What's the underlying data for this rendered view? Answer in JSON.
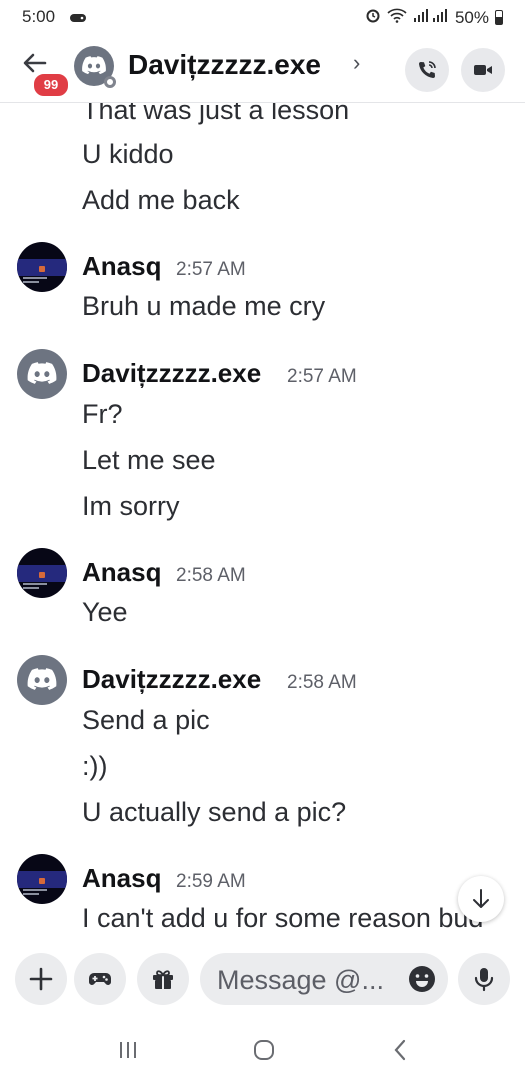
{
  "status_bar": {
    "time": "5:00",
    "battery": "50%"
  },
  "header": {
    "back_badge": "99",
    "title": "Davițzzzzz.exe",
    "chevron": "›"
  },
  "messages": [
    {
      "type": "continuation",
      "lines": [
        "That was just a lesson",
        "U kiddo",
        "Add me back"
      ]
    },
    {
      "type": "group",
      "author": "Anasq",
      "time": "2:57 AM",
      "avatar": "anasq-avatar",
      "lines": [
        "Bruh u made me cry"
      ]
    },
    {
      "type": "group",
      "author": "Davițzzzzz.exe",
      "time": "2:57 AM",
      "avatar": "discord-default-avatar",
      "lines": [
        "Fr?",
        "Let me see",
        "Im sorry"
      ]
    },
    {
      "type": "group",
      "author": "Anasq",
      "time": "2:58 AM",
      "avatar": "anasq-avatar",
      "lines": [
        "Yee"
      ]
    },
    {
      "type": "group",
      "author": "Davițzzzzz.exe",
      "time": "2:58 AM",
      "avatar": "discord-default-avatar",
      "lines": [
        "Send a pic",
        ":))",
        "U actually send a pic?"
      ]
    },
    {
      "type": "group",
      "author": "Anasq",
      "time": "2:59 AM",
      "avatar": "anasq-avatar",
      "lines": [
        "I can't add u for some reason bud"
      ]
    }
  ],
  "composer": {
    "placeholder": "Message @..."
  },
  "icons": [
    "back-arrow-icon",
    "phone-call-icon",
    "video-camera-icon",
    "plus-icon",
    "gamepad-icon",
    "gift-icon",
    "emoji-icon",
    "microphone-icon",
    "arrow-down-icon",
    "recents-icon",
    "home-icon",
    "back-nav-icon"
  ],
  "colors": {
    "badge": "#e03d45",
    "button_bg": "#ebecee",
    "default_avatar": "#6d7481"
  }
}
